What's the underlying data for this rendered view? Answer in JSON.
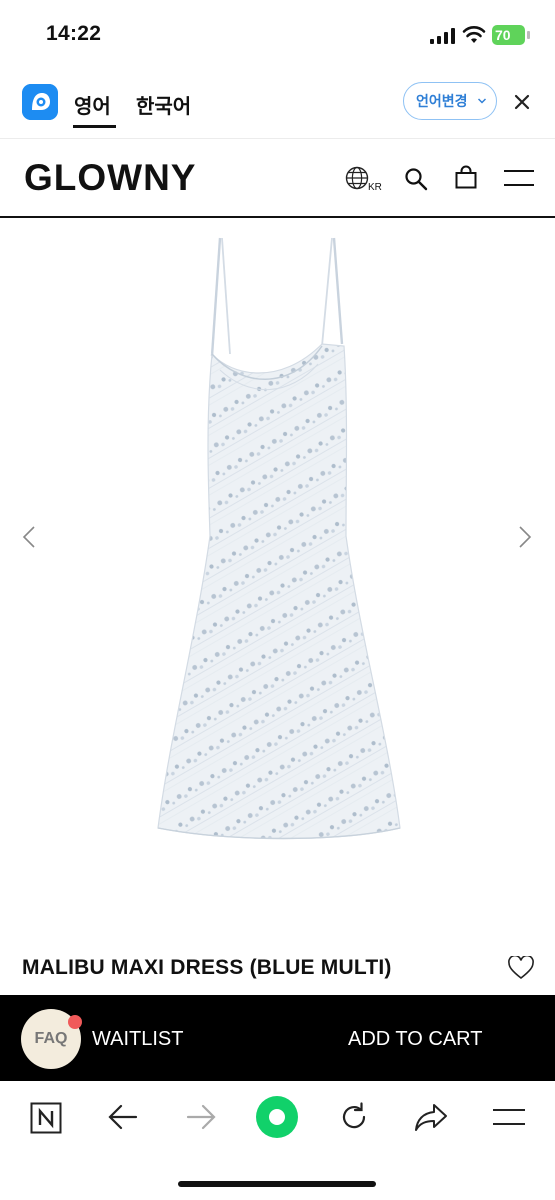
{
  "status_bar": {
    "time": "14:22",
    "battery": "70"
  },
  "translator": {
    "active_lang": "영어",
    "other_lang": "한국어",
    "change_label": "언어변경"
  },
  "header": {
    "brand": "GLOWNY",
    "region": "KR"
  },
  "product": {
    "title": "MALIBU MAXI DRESS (BLUE MULTI)"
  },
  "cart_bar": {
    "faq": "FAQ",
    "waitlist": "WAITLIST",
    "add_to_cart": "ADD TO CART"
  },
  "browser_toolbar": {
    "icons": [
      "naver-n-icon",
      "back-arrow-icon",
      "forward-arrow-icon",
      "green-dot-icon",
      "reload-icon",
      "share-icon",
      "menu-icon"
    ]
  },
  "colors": {
    "accent_green": "#11d16a",
    "papago_blue": "#1d8cf2",
    "battery_green": "#5fd35a"
  }
}
